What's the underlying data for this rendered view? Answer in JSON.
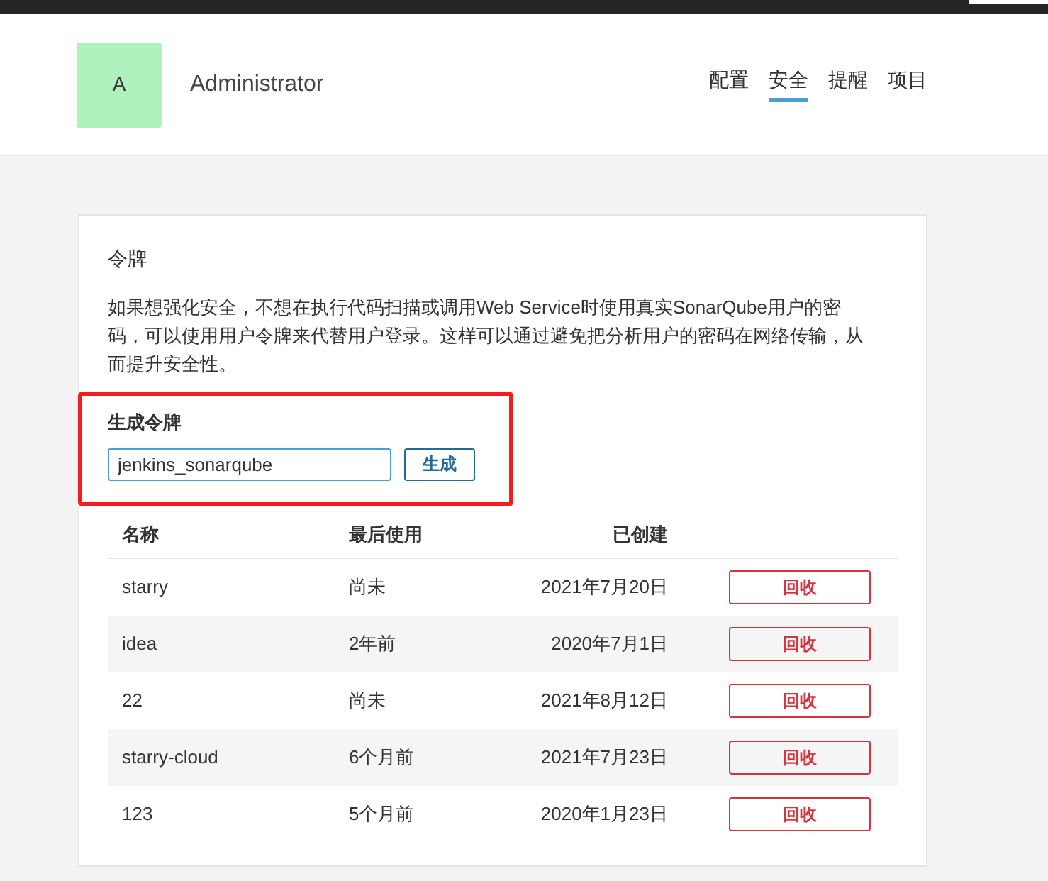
{
  "user": {
    "avatar_letter": "A",
    "name": "Administrator"
  },
  "tabs": [
    {
      "label": "配置",
      "selected": false
    },
    {
      "label": "安全",
      "selected": true
    },
    {
      "label": "提醒",
      "selected": false
    },
    {
      "label": "项目",
      "selected": false
    }
  ],
  "tokens": {
    "title": "令牌",
    "description": "如果想强化安全，不想在执行代码扫描或调用Web Service时使用真实SonarQube用户的密码，可以使用用户令牌来代替用户登录。这样可以通过避免把分析用户的密码在网络传输，从而提升安全性。",
    "generate": {
      "title": "生成令牌",
      "value": "jenkins_sonarqube",
      "button": "生成"
    },
    "columns": [
      "名称",
      "最后使用",
      "已创建"
    ],
    "rows": [
      {
        "name": "starry",
        "last_used": "尚未",
        "created": "2021年7月20日",
        "action": "回收"
      },
      {
        "name": "idea",
        "last_used": "2年前",
        "created": "2020年7月1日",
        "action": "回收"
      },
      {
        "name": "22",
        "last_used": "尚未",
        "created": "2021年8月12日",
        "action": "回收"
      },
      {
        "name": "starry-cloud",
        "last_used": "6个月前",
        "created": "2021年7月23日",
        "action": "回收"
      },
      {
        "name": "123",
        "last_used": "5个月前",
        "created": "2020年1月23日",
        "action": "回收"
      }
    ]
  }
}
